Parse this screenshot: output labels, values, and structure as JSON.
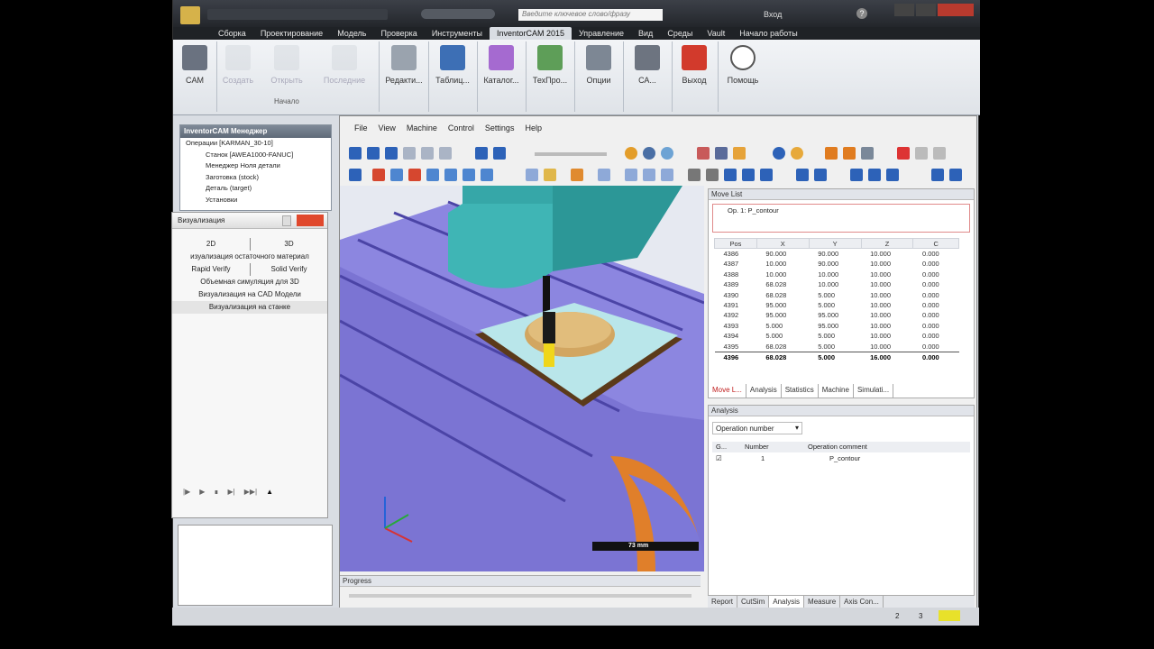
{
  "title_bar": {
    "search_placeholder": "Введите ключевое слово/фразу",
    "login": "Вход",
    "help": "?"
  },
  "menu_tabs": [
    "Сборка",
    "Проектирование",
    "Модель",
    "Проверка",
    "Инструменты",
    "InventorCAM 2015",
    "Управление",
    "Вид",
    "Среды",
    "Vault",
    "Начало работы"
  ],
  "ribbon": {
    "cam": "CAM",
    "create": "Создать",
    "open": "Открыть",
    "recent": "Последние",
    "start_group": "Начало",
    "edit": "Редакти...",
    "tables": "Таблиц...",
    "catalogs": "Каталог...",
    "techproc": "ТехПро...",
    "options": "Опции",
    "ca": "СА...",
    "exit": "Выход",
    "help": "Помощь"
  },
  "manager": {
    "title": "InventorCAM Менеджер",
    "items": [
      "Операции [KARMAN_30-10]",
      "Станок [AWEA1000-FANUC]",
      "Менеджер Ноля детали",
      "Заготовка (stock)",
      "Деталь (target)",
      "Установки"
    ]
  },
  "visualization": {
    "title": "Визуализация",
    "mode_2d": "2D",
    "mode_3d": "3D",
    "residual": "изуализация остаточного материал",
    "rapid": "Rapid Verify",
    "solid": "Solid Verify",
    "volume_sim": "Объемная симуляция для 3D",
    "cad_vis": "Визуализация на  CAD Модели",
    "machine_vis": "Визуализация на станке"
  },
  "cam_window": {
    "menu": [
      "File",
      "View",
      "Machine",
      "Control",
      "Settings",
      "Help"
    ],
    "scale_label": "73 mm",
    "progress_title": "Progress"
  },
  "move_list": {
    "title": "Move List",
    "op": "Op. 1: P_contour",
    "columns": [
      "Pos",
      "X",
      "Y",
      "Z",
      "C"
    ],
    "rows": [
      [
        "4386",
        "90.000",
        "90.000",
        "10.000",
        "0.000"
      ],
      [
        "4387",
        "10.000",
        "90.000",
        "10.000",
        "0.000"
      ],
      [
        "4388",
        "10.000",
        "10.000",
        "10.000",
        "0.000"
      ],
      [
        "4389",
        "68.028",
        "10.000",
        "10.000",
        "0.000"
      ],
      [
        "4390",
        "68.028",
        "5.000",
        "10.000",
        "0.000"
      ],
      [
        "4391",
        "95.000",
        "5.000",
        "10.000",
        "0.000"
      ],
      [
        "4392",
        "95.000",
        "95.000",
        "10.000",
        "0.000"
      ],
      [
        "4393",
        "5.000",
        "95.000",
        "10.000",
        "0.000"
      ],
      [
        "4394",
        "5.000",
        "5.000",
        "10.000",
        "0.000"
      ],
      [
        "4395",
        "68.028",
        "5.000",
        "10.000",
        "0.000"
      ],
      [
        "4396",
        "68.028",
        "5.000",
        "16.000",
        "0.000"
      ]
    ],
    "tabs": [
      "Move L...",
      "Analysis",
      "Statistics",
      "Machine",
      "Simulati..."
    ]
  },
  "analysis": {
    "title": "Analysis",
    "dropdown": "Operation number",
    "columns": [
      "G...",
      "Number",
      "Operation comment"
    ],
    "row": {
      "number": "1",
      "comment": "P_contour"
    },
    "bottom_tabs": [
      "Report",
      "CutSim",
      "Analysis",
      "Measure",
      "Axis Con..."
    ]
  },
  "status": {
    "a": "2",
    "b": "3"
  }
}
